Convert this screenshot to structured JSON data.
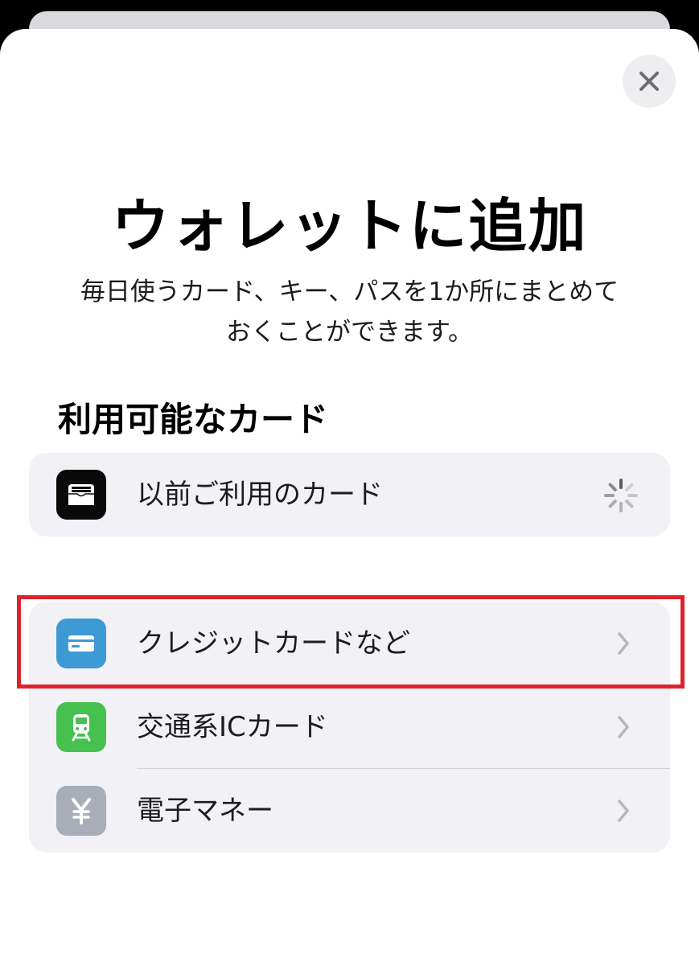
{
  "title": "ウォレットに追加",
  "subtitle_line1": "毎日使うカード、キー、パスを1か所にまとめて",
  "subtitle_line2": "おくことができます。",
  "section_title": "利用可能なカード",
  "previous_cards": {
    "label": "以前ご利用のカード",
    "icon": "wallet-icon"
  },
  "options": [
    {
      "label": "クレジットカードなど",
      "icon": "credit-card-icon",
      "icon_color": "#3e9ad5"
    },
    {
      "label": "交通系ICカード",
      "icon": "train-icon",
      "icon_color": "#46c14f"
    },
    {
      "label": "電子マネー",
      "icon": "yen-icon",
      "icon_color": "#a9adb8"
    }
  ],
  "colors": {
    "highlight": "#e0222b",
    "row_background": "#f1f1f6"
  }
}
